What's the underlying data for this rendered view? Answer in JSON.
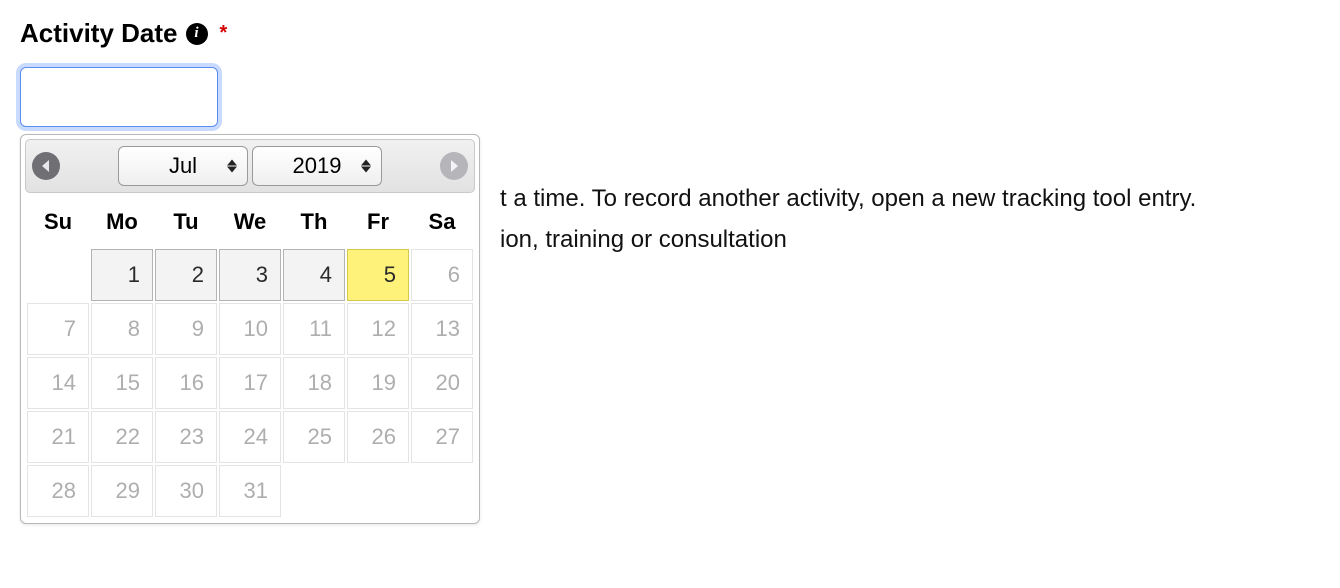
{
  "field": {
    "label": "Activity Date",
    "info_glyph": "i",
    "required_glyph": "*",
    "input_value": ""
  },
  "datepicker": {
    "month_label": "Jul",
    "year_label": "2019",
    "day_headers": [
      "Su",
      "Mo",
      "Tu",
      "We",
      "Th",
      "Fr",
      "Sa"
    ],
    "grid": [
      [
        null,
        "1",
        "2",
        "3",
        "4",
        "5",
        "6"
      ],
      [
        "7",
        "8",
        "9",
        "10",
        "11",
        "12",
        "13"
      ],
      [
        "14",
        "15",
        "16",
        "17",
        "18",
        "19",
        "20"
      ],
      [
        "21",
        "22",
        "23",
        "24",
        "25",
        "26",
        "27"
      ],
      [
        "28",
        "29",
        "30",
        "31",
        null,
        null,
        null
      ]
    ],
    "today_row": 0,
    "today_col": 5
  },
  "background_text": {
    "line1_suffix": "t a time. To record another activity, open a new tracking tool entry.",
    "line2_suffix": "ion, training or consultation"
  }
}
